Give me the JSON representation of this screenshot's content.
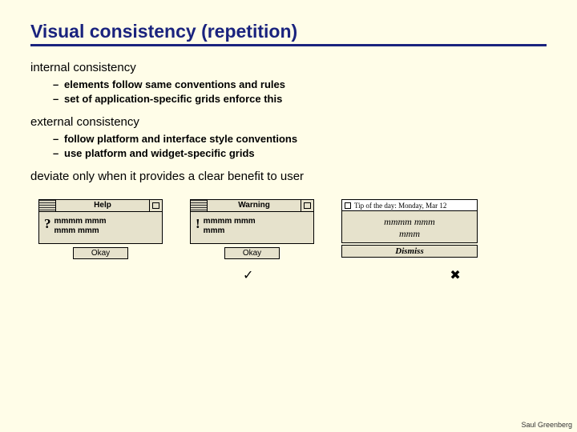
{
  "title": "Visual consistency (repetition)",
  "sections": [
    {
      "head": "internal consistency",
      "bullets": [
        "elements follow same conventions and rules",
        "set of application-specific grids enforce this"
      ]
    },
    {
      "head": "external consistency",
      "bullets": [
        "follow platform and interface style conventions",
        "use platform and widget-specific grids"
      ]
    }
  ],
  "final": "deviate only when it provides a clear benefit to user",
  "dialogs": {
    "d1": {
      "title": "Help",
      "symbol": "?",
      "msg1": "mmmm mmm",
      "msg2": "mmm mmm",
      "button": "Okay"
    },
    "d2": {
      "title": "Warning",
      "symbol": "!",
      "msg1": "mmmm mmm",
      "msg2": "mmm",
      "button": "Okay"
    },
    "d3": {
      "title": "Tip of the day: Monday, Mar 12",
      "msg1": "mmmm mmm",
      "msg2": "mmm",
      "button": "Dismiss"
    }
  },
  "marks": {
    "check": "✓",
    "cross": "✖"
  },
  "footer": "Saul Greenberg"
}
